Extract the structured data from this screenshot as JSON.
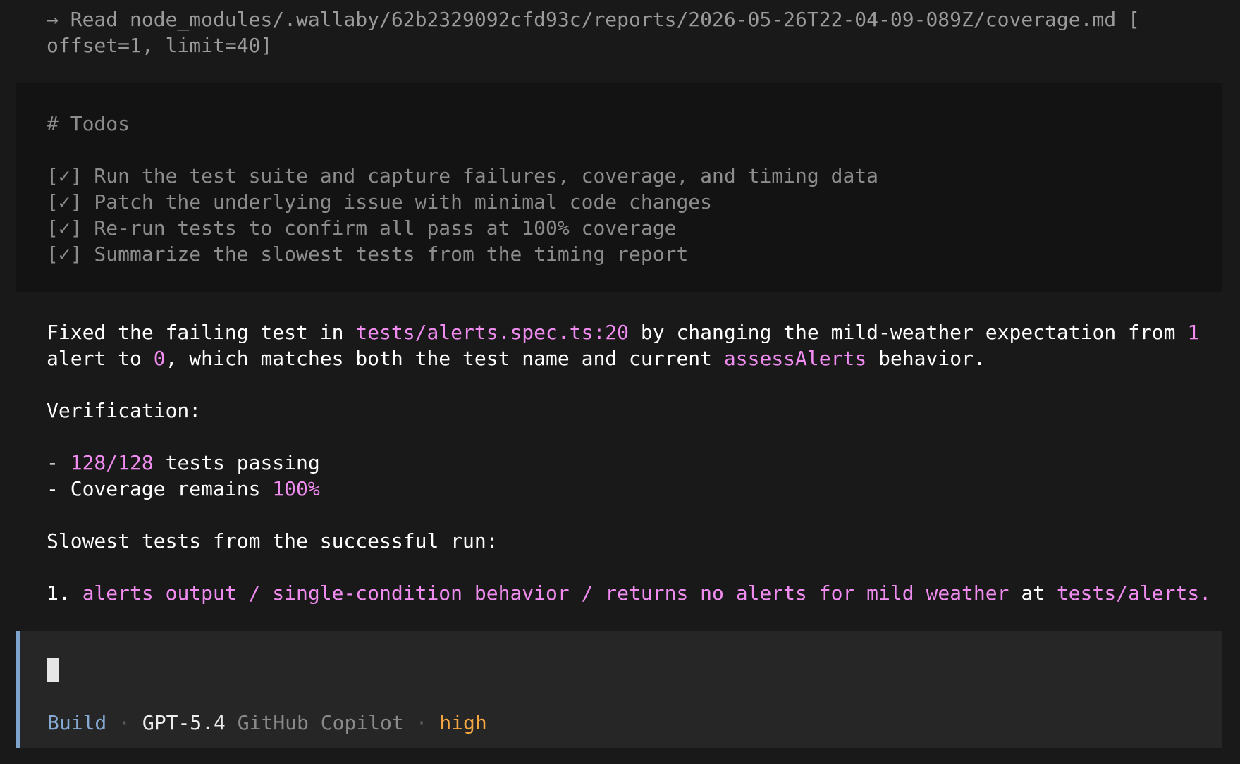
{
  "read_call": {
    "arrow": "→",
    "line1": "Read node_modules/.wallaby/62b2329092cfd93c/reports/2026-05-26T22-04-09-089Z/coverage.md [",
    "line2": "offset=1, limit=40]"
  },
  "todos": {
    "heading": "# Todos",
    "items": [
      "[✓] Run the test suite and capture failures, coverage, and timing data",
      "[✓] Patch the underlying issue with minimal code changes",
      "[✓] Re-run tests to confirm all pass at 100% coverage",
      "[✓] Summarize the slowest tests from the timing report"
    ]
  },
  "summary": {
    "p1": {
      "a": "Fixed the failing test in ",
      "file": "tests/alerts.spec.ts:20",
      "b": " by changing the mild-weather expectation from ",
      "from_val": "1",
      "c": "alert to ",
      "to_val": "0",
      "d": ", which matches both the test name and current ",
      "fn": "assessAlerts",
      "e": " behavior."
    },
    "verification_label": "Verification:",
    "v1_prefix": "- ",
    "v1_value": "128/128",
    "v1_text": " tests passing",
    "v2_prefix": "- Coverage remains ",
    "v2_value": "100%",
    "slowest_label": "Slowest tests from the successful run:",
    "slow1_num": "1. ",
    "slow1_name": "alerts output / single-condition behavior / returns no alerts for mild weather",
    "slow1_at": " at ",
    "slow1_file": "tests/alerts."
  },
  "prompt": {
    "mode": "Build",
    "separator": " · ",
    "model": "GPT-5.4",
    "provider": " GitHub Copilot",
    "effort": "high"
  },
  "colors": {
    "background": "#191919",
    "highlight": "#f08cf0",
    "accent": "#7ea3cc",
    "effort": "#f5a742"
  }
}
